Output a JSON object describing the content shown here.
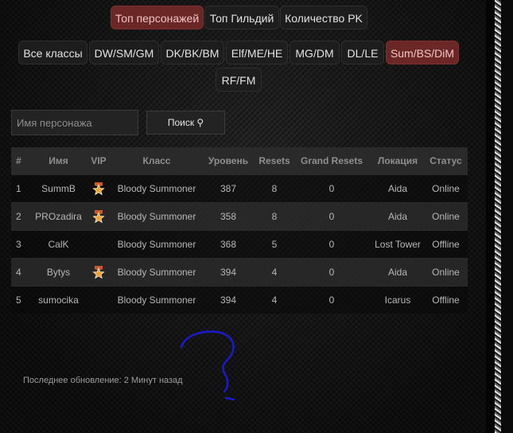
{
  "top_tabs": [
    {
      "label": "Топ персонажей",
      "active": true
    },
    {
      "label": "Топ Гильдий",
      "active": false
    },
    {
      "label": "Количество PK",
      "active": false
    }
  ],
  "class_filters": [
    {
      "label": "Все классы",
      "active": false
    },
    {
      "label": "DW/SM/GM",
      "active": false
    },
    {
      "label": "DK/BK/BM",
      "active": false
    },
    {
      "label": "Elf/ME/HE",
      "active": false
    },
    {
      "label": "MG/DM",
      "active": false
    },
    {
      "label": "DL/LE",
      "active": false
    },
    {
      "label": "Sum/BS/DiM",
      "active": true
    },
    {
      "label": "RF/FM",
      "active": false
    }
  ],
  "search": {
    "placeholder": "Имя персонажа",
    "button_label": "Поиск ⚲"
  },
  "table": {
    "headers": [
      "#",
      "Имя",
      "VIP",
      "Класс",
      "Уровень",
      "Resets",
      "Grand Resets",
      "Локация",
      "Статус"
    ],
    "rows": [
      {
        "num": "1",
        "name": "SummB",
        "vip": true,
        "class": "Bloody Summoner",
        "level": "387",
        "resets": "8",
        "grand": "0",
        "location": "Aida",
        "status": "Online"
      },
      {
        "num": "2",
        "name": "PROzadira",
        "vip": true,
        "class": "Bloody Summoner",
        "level": "358",
        "resets": "8",
        "grand": "0",
        "location": "Aida",
        "status": "Online"
      },
      {
        "num": "3",
        "name": "CalK",
        "vip": false,
        "class": "Bloody Summoner",
        "level": "368",
        "resets": "5",
        "grand": "0",
        "location": "Lost Tower",
        "status": "Offline"
      },
      {
        "num": "4",
        "name": "Bytys",
        "vip": true,
        "class": "Bloody Summoner",
        "level": "394",
        "resets": "4",
        "grand": "0",
        "location": "Aida",
        "status": "Online"
      },
      {
        "num": "5",
        "name": "sumocika",
        "vip": false,
        "class": "Bloody Summoner",
        "level": "394",
        "resets": "4",
        "grand": "0",
        "location": "Icarus",
        "status": "Offline"
      }
    ]
  },
  "footer": {
    "last_update": "Последнее обновление: 2 Минут назад"
  },
  "colors": {
    "accent": "#6b2626",
    "online": "#3fb03f",
    "offline": "#e22424",
    "vip_star": "#f0a030"
  },
  "icons": {
    "vip": "vip-star-icon",
    "search": "search-icon",
    "annotation": "question-mark-scribble"
  }
}
